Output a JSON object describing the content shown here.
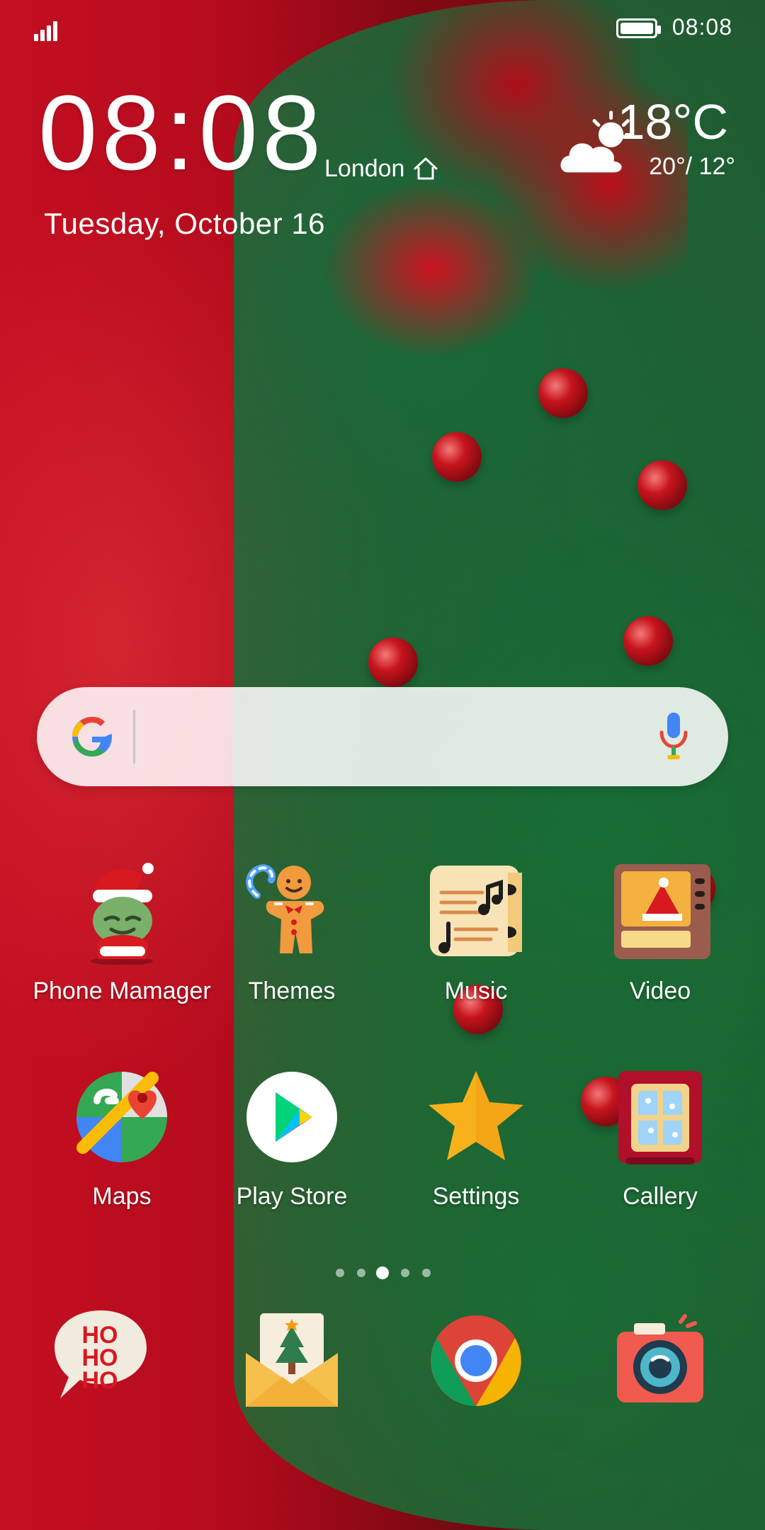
{
  "status_bar": {
    "time": "08:08"
  },
  "clock_widget": {
    "time": "08:08",
    "location": "London",
    "date": "Tuesday, October 16",
    "temperature": "18°C",
    "range": "20°/ 12°"
  },
  "search": {
    "placeholder": ""
  },
  "apps_row1": [
    {
      "label": "Phone Mamager",
      "icon": "grinch-santa-icon"
    },
    {
      "label": "Themes",
      "icon": "gingerbread-man-icon"
    },
    {
      "label": "Music",
      "icon": "music-sheet-icon"
    },
    {
      "label": "Video",
      "icon": "video-player-icon"
    }
  ],
  "apps_row2": [
    {
      "label": "Maps",
      "icon": "maps-icon"
    },
    {
      "label": "Play Store",
      "icon": "play-store-icon"
    },
    {
      "label": "Settings",
      "icon": "star-settings-icon"
    },
    {
      "label": "Callery",
      "icon": "window-gallery-icon"
    }
  ],
  "page_indicator": {
    "count": 5,
    "active_index": 2
  },
  "dock": [
    {
      "icon": "hohoho-bubble-icon",
      "text": [
        "HO",
        "HO",
        "HO"
      ]
    },
    {
      "icon": "christmas-card-envelope-icon"
    },
    {
      "icon": "chrome-icon"
    },
    {
      "icon": "camera-icon"
    }
  ]
}
